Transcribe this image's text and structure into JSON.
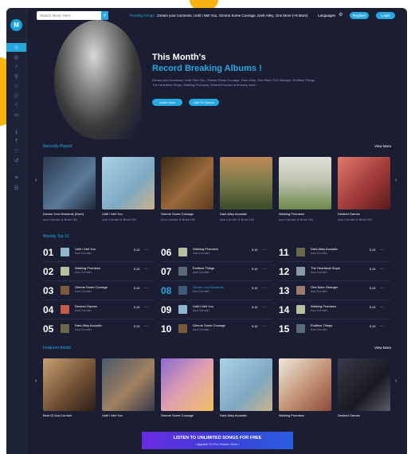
{
  "topbar": {
    "search_placeholder": "Search Music Here..",
    "trending_label": "Trending Songs :",
    "trending_text": "Dream your moments, Until I Met You, Gimme Some Courage, Dark Alley, One More (+8 More)",
    "language": "Languages",
    "register": "Register",
    "login": "Login"
  },
  "logo": "M",
  "sidebar": {
    "icons": [
      "home-icon",
      "compass-icon",
      "music-icon",
      "mic-icon",
      "star-icon",
      "diamond-icon",
      "headphones-icon",
      "tv-icon",
      "download-icon",
      "upload-icon",
      "heart-icon",
      "history-icon",
      "playlist-add-icon",
      "queue-icon"
    ]
  },
  "hero": {
    "title_line1": "This Month's",
    "title_line2": "Record Breaking Albums !",
    "description": "Dream your moments, Until I Met You, Gimme Some Courage, Dark Alley, One More Of A Stranger, Endless Things, The Heartbeat Stops, Walking Promises, Desired Games and many more...",
    "listen_btn": "Listen Now",
    "queue_btn": "Add To Queue"
  },
  "recently_played": {
    "title": "Recently Played",
    "view_more": "View More",
    "items": [
      {
        "title": "Dream Your Moments (Duet)",
        "artist": "Ava Cornish & Brian Hill",
        "color": "#3d5a7a"
      },
      {
        "title": "Until I Met You",
        "artist": "Ava Cornish & Brian Hill",
        "color": "#8fb7cf"
      },
      {
        "title": "Gimme Some Courage",
        "artist": "Ava Cornish & Brian Hill",
        "color": "#7a5a3a"
      },
      {
        "title": "Dark Alley Acoustic",
        "artist": "Ava Cornish & Brian Hill",
        "color": "#6a6a4a"
      },
      {
        "title": "Walking Promises",
        "artist": "Ava Cornish & Brian Hill",
        "color": "#b8c0a0"
      },
      {
        "title": "Desired Games",
        "artist": "Ava Cornish & Brian Hill",
        "color": "#c45a4a"
      }
    ]
  },
  "weekly": {
    "title": "Weekly Top 15",
    "columns": [
      [
        {
          "num": "01",
          "title": "Until I Met You",
          "artist": "Ava Cornish",
          "dur": "5:10",
          "color": "#8fb7cf"
        },
        {
          "num": "02",
          "title": "Walking Promises",
          "artist": "Ava Cornish",
          "dur": "5:10",
          "color": "#b8c0a0"
        },
        {
          "num": "03",
          "title": "Gimme Some Courage",
          "artist": "Ava Cornish",
          "dur": "5:10",
          "color": "#7a5a3a"
        },
        {
          "num": "04",
          "title": "Desired Games",
          "artist": "Ava Cornish",
          "dur": "5:10",
          "color": "#c45a4a"
        },
        {
          "num": "05",
          "title": "Dark Alley Acoustic",
          "artist": "Ava Cornish",
          "dur": "5:10",
          "color": "#6a6a4a"
        }
      ],
      [
        {
          "num": "06",
          "title": "Walking Promises",
          "artist": "Ava Cornish",
          "dur": "5:10",
          "color": "#b8c0a0"
        },
        {
          "num": "07",
          "title": "Endless Things",
          "artist": "Ava Cornish",
          "dur": "5:10",
          "color": "#5a6a7a"
        },
        {
          "num": "08",
          "title": "Dream Your Moments",
          "artist": "Ava Cornish",
          "dur": "5:10",
          "color": "#3d5a7a",
          "highlight": true
        },
        {
          "num": "09",
          "title": "Until I Met You",
          "artist": "Ava Cornish",
          "dur": "5:10",
          "color": "#8fb7cf"
        },
        {
          "num": "10",
          "title": "Gimme Some Courage",
          "artist": "Ava Cornish",
          "dur": "5:10",
          "color": "#7a5a3a"
        }
      ],
      [
        {
          "num": "11",
          "title": "Dark Alley Acoustic",
          "artist": "Ava Cornish",
          "dur": "5:10",
          "color": "#6a6a4a"
        },
        {
          "num": "12",
          "title": "The Heartbeat Stops",
          "artist": "Ava Cornish",
          "dur": "5:10",
          "color": "#8a9aaa"
        },
        {
          "num": "13",
          "title": "One More Stranger",
          "artist": "Ava Cornish",
          "dur": "5:10",
          "color": "#9a7a6a"
        },
        {
          "num": "14",
          "title": "Walking Promises",
          "artist": "Ava Cornish",
          "dur": "5:10",
          "color": "#b8c0a0"
        },
        {
          "num": "15",
          "title": "Endless Things",
          "artist": "Ava Cornish",
          "dur": "5:10",
          "color": "#5a6a7a"
        }
      ]
    ]
  },
  "featured": {
    "title": "Featured Artists",
    "view_more": "View More",
    "items": [
      {
        "name": "Best Of Ava Cornish",
        "color": "#8a6a4a"
      },
      {
        "name": "Until I Met You",
        "color": "#6a8aa0"
      },
      {
        "name": "Gimme Some Courage",
        "color": "#b090d0"
      },
      {
        "name": "Dark Alley Acoustic",
        "color": "#8fb7cf"
      },
      {
        "name": "Walking Promises",
        "color": "#d0c0b0"
      },
      {
        "name": "Desired Games",
        "color": "#2a2a3a"
      }
    ]
  },
  "banner": {
    "line1": "LISTEN TO UNLIMITED SONGS FOR FREE",
    "line2": "Upgrade To Pro Version Now !"
  },
  "colors": {
    "accent": "#27a8e0",
    "bg": "#1b1e33",
    "sidebar": "#1f2338",
    "highlight_orange": "#f6b312"
  }
}
